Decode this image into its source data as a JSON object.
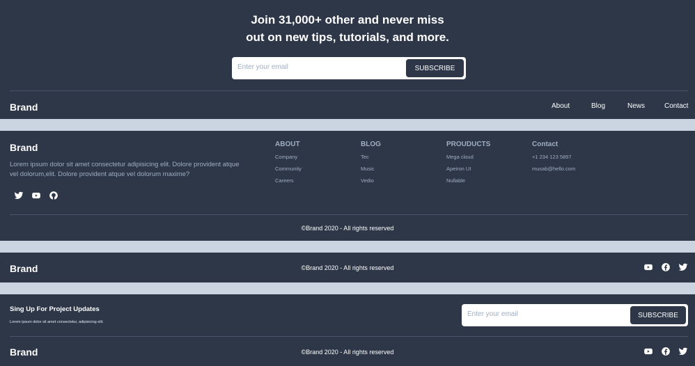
{
  "hero": {
    "line1": "Join 31,000+ other and never miss",
    "line2": "out on new tips, tutorials, and more.",
    "email_placeholder": "Enter your email",
    "subscribe_label": "SUBSCRIBE"
  },
  "nav_footer": {
    "brand": "Brand",
    "links": [
      "About",
      "Blog",
      "News",
      "Contact"
    ]
  },
  "big_footer": {
    "brand": "Brand",
    "description": "Lorem ipsum dolor sit amet consectetur adipisicing elit. Dolore provident atque vel dolorum,elit. Dolore provident atque vel dolorum maxime?",
    "social_icons": [
      "twitter-icon",
      "youtube-icon",
      "github-icon"
    ],
    "columns": [
      {
        "title": "ABOUT",
        "items": [
          "Company",
          "Community",
          "Careers"
        ]
      },
      {
        "title": "BLOG",
        "items": [
          "Tec",
          "Music",
          "Vedio"
        ]
      },
      {
        "title": "PROUDUCTS",
        "items": [
          "Mega cloud",
          "Apeiron UI",
          "Nullable"
        ]
      },
      {
        "title": "Contact",
        "items": [
          "+1 234 123 5897",
          "musab@hello.com"
        ]
      }
    ],
    "copyright": "©Brand 2020 - All rights reserved"
  },
  "simple_footer": {
    "brand": "Brand",
    "copyright": "©Brand 2020 - All rights reserved",
    "social_icons": [
      "youtube-icon",
      "facebook-icon",
      "twitter-icon"
    ]
  },
  "signup_footer": {
    "title": "Sing Up For Project Updates",
    "subtitle": "Lorem ipsum dolor sit amet consectetur, adipisicing elit.",
    "email_placeholder": "Enter your email",
    "subscribe_label": "SUBSCRIBE",
    "brand": "Brand",
    "copyright": "©Brand 2020 - All rights reserved",
    "social_icons": [
      "youtube-icon",
      "facebook-icon",
      "twitter-icon"
    ]
  },
  "colors": {
    "dark": "#2d3748",
    "separator": "#cbd5e1",
    "muted_text": "#a0aec0",
    "white": "#ffffff"
  }
}
